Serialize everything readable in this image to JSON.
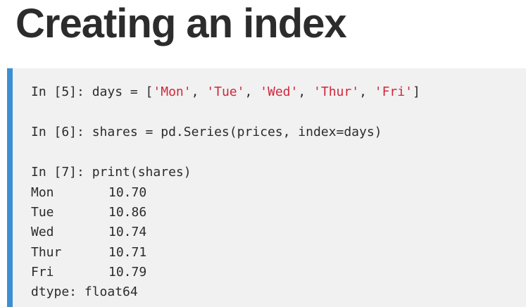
{
  "title": "Creating an index",
  "cells": [
    {
      "prompt": "In [5]:",
      "code_prefix": "days = [",
      "strings": [
        "'Mon'",
        "'Tue'",
        "'Wed'",
        "'Thur'",
        "'Fri'"
      ],
      "separator": ", ",
      "code_suffix": "]"
    },
    {
      "prompt": "In [6]:",
      "code": "shares = pd.Series(prices, index=days)"
    },
    {
      "prompt": "In [7]:",
      "code": "print(shares)"
    }
  ],
  "output": {
    "rows": [
      {
        "index": "Mon",
        "value": "10.70"
      },
      {
        "index": "Tue",
        "value": "10.86"
      },
      {
        "index": "Wed",
        "value": "10.74"
      },
      {
        "index": "Thur",
        "value": "10.71"
      },
      {
        "index": "Fri",
        "value": "10.79"
      }
    ],
    "dtype": "dtype: float64"
  },
  "colors": {
    "accent_bar": "#3d8fd1",
    "string_literal": "#d0273a",
    "code_background": "#f1f1f1"
  }
}
